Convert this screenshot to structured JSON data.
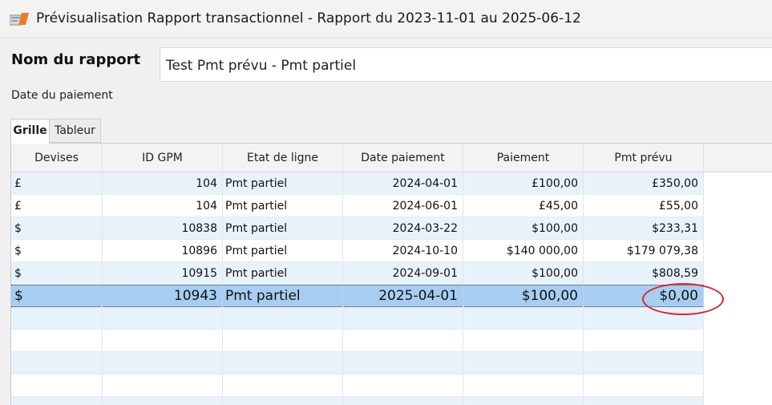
{
  "window": {
    "title": "Prévisualisation Rapport transactionnel - Rapport du 2023-11-01 au 2025-06-12",
    "icon": "report-app-icon"
  },
  "form": {
    "name_label": "Nom du rapport",
    "name_value": "Test Pmt prévu - Pmt partiel",
    "date_label": "Date du paiement"
  },
  "tabs": [
    {
      "label": "Grille",
      "active": true
    },
    {
      "label": "Tableur",
      "active": false
    }
  ],
  "grid": {
    "columns": [
      "Devises",
      "ID GPM",
      "Etat de ligne",
      "Date paiement",
      "Paiement",
      "Pmt prévu"
    ],
    "rows": [
      {
        "devise": "£",
        "id": "104",
        "etat": "Pmt partiel",
        "date": "2024-04-01",
        "paiement": "£100,00",
        "prevu": "£350,00"
      },
      {
        "devise": "£",
        "id": "104",
        "etat": "Pmt partiel",
        "date": "2024-06-01",
        "paiement": "£45,00",
        "prevu": "£55,00"
      },
      {
        "devise": "$",
        "id": "10838",
        "etat": "Pmt partiel",
        "date": "2024-03-22",
        "paiement": "$100,00",
        "prevu": "$233,31"
      },
      {
        "devise": "$",
        "id": "10896",
        "etat": "Pmt partiel",
        "date": "2024-10-10",
        "paiement": "$140 000,00",
        "prevu": "$179 079,38"
      },
      {
        "devise": "$",
        "id": "10915",
        "etat": "Pmt partiel",
        "date": "2024-09-01",
        "paiement": "$100,00",
        "prevu": "$808,59"
      },
      {
        "devise": "$",
        "id": "10943",
        "etat": "Pmt partiel",
        "date": "2025-04-01",
        "paiement": "$100,00",
        "prevu": "$0,00"
      }
    ],
    "selected_row": 5
  },
  "colors": {
    "selection": "#a7cef2",
    "stripe": "#e8f2fb",
    "highlight": "#d9262a"
  }
}
